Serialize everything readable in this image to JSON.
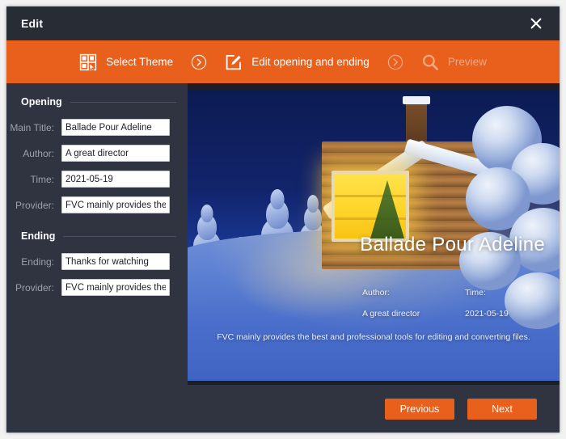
{
  "window": {
    "title": "Edit",
    "close_icon": "close-icon"
  },
  "steps": {
    "items": [
      {
        "label": "Select Theme",
        "icon": "theme-grid-icon",
        "state": "active"
      },
      {
        "label": "Edit opening and ending",
        "icon": "edit-pencil-icon",
        "state": "active"
      },
      {
        "label": "Preview",
        "icon": "search-magnifier-icon",
        "state": "inactive"
      }
    ],
    "separator_icon": "chevron-right-circle-icon",
    "accent_color": "#e8601c"
  },
  "sidebar": {
    "opening": {
      "section_title": "Opening",
      "fields": [
        {
          "label": "Main Title:",
          "value": "Ballade Pour Adeline",
          "name": "main-title-input"
        },
        {
          "label": "Author:",
          "value": "A great director",
          "name": "author-input"
        },
        {
          "label": "Time:",
          "value": "2021-05-19",
          "name": "time-input"
        },
        {
          "label": "Provider:",
          "value": "FVC mainly provides the best and professional tools for editing and converting files.",
          "name": "opening-provider-input"
        }
      ]
    },
    "ending": {
      "section_title": "Ending",
      "fields": [
        {
          "label": "Ending:",
          "value": "Thanks for watching",
          "name": "ending-input"
        },
        {
          "label": "Provider:",
          "value": "FVC mainly provides the best and professional tools for editing and converting files.",
          "name": "ending-provider-input"
        }
      ]
    }
  },
  "preview": {
    "title": "Ballade Pour Adeline",
    "author_label": "Author:",
    "author_value": "A great director",
    "time_label": "Time:",
    "time_value": "2021-05-19",
    "provider_text": "FVC mainly provides the best and professional tools for editing and converting files."
  },
  "footer": {
    "previous_label": "Previous",
    "next_label": "Next"
  }
}
